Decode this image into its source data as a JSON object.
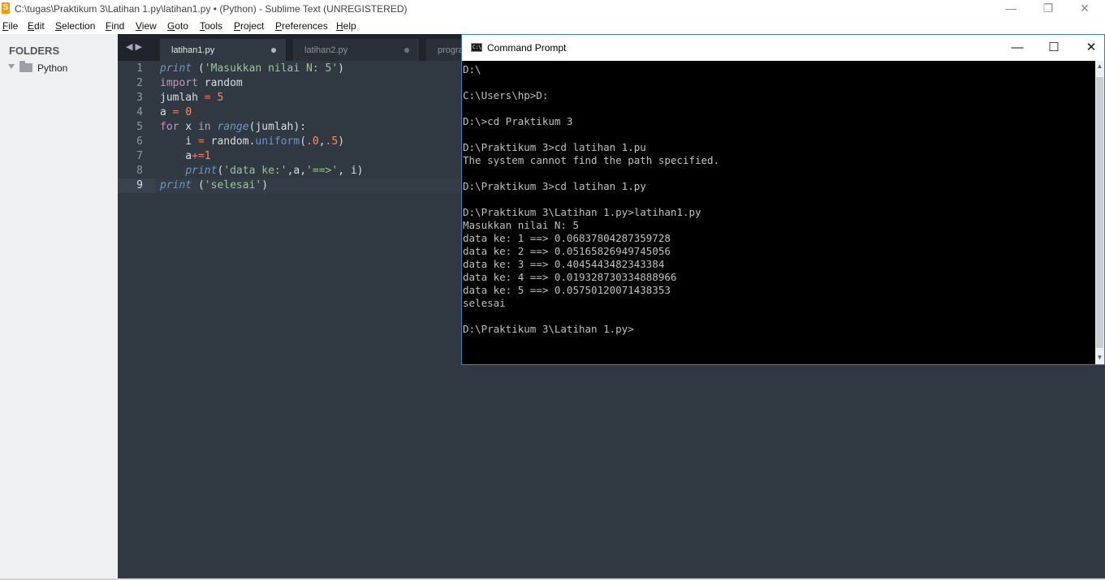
{
  "window": {
    "title": "C:\\tugas\\Praktikum 3\\Latihan 1.py\\latihan1.py • (Python) - Sublime Text (UNREGISTERED)",
    "app_icon": "S"
  },
  "menu": [
    "File",
    "Edit",
    "Selection",
    "Find",
    "View",
    "Goto",
    "Tools",
    "Project",
    "Preferences",
    "Help"
  ],
  "sidebar": {
    "heading": "FOLDERS",
    "folder": "Python"
  },
  "tabs": {
    "nav": "◀ ▶",
    "items": [
      {
        "label": "latihan1.py",
        "active": true
      },
      {
        "label": "latihan2.py",
        "active": false
      },
      {
        "label": "progra",
        "active": false
      }
    ]
  },
  "editor": {
    "line_numbers": [
      "1",
      "2",
      "3",
      "4",
      "5",
      "6",
      "7",
      "8",
      "9"
    ],
    "current_line": 9
  },
  "cmd": {
    "title": "Command Prompt",
    "lines": [
      "D:\\",
      "",
      "C:\\Users\\hp>D:",
      "",
      "D:\\>cd Praktikum 3",
      "",
      "D:\\Praktikum 3>cd latihan 1.pu",
      "The system cannot find the path specified.",
      "",
      "D:\\Praktikum 3>cd latihan 1.py",
      "",
      "D:\\Praktikum 3\\Latihan 1.py>latihan1.py",
      "Masukkan nilai N: 5",
      "data ke: 1 ==> 0.06837804287359728",
      "data ke: 2 ==> 0.05165826949745056",
      "data ke: 3 ==> 0.4045443482343384",
      "data ke: 4 ==> 0.019328730334888966",
      "data ke: 5 ==> 0.05750120071438353",
      "selesai",
      "",
      "D:\\Praktikum 3\\Latihan 1.py>"
    ]
  },
  "icons": {
    "minimize": "—",
    "restore": "❐",
    "close": "✕",
    "maximize": "☐"
  }
}
